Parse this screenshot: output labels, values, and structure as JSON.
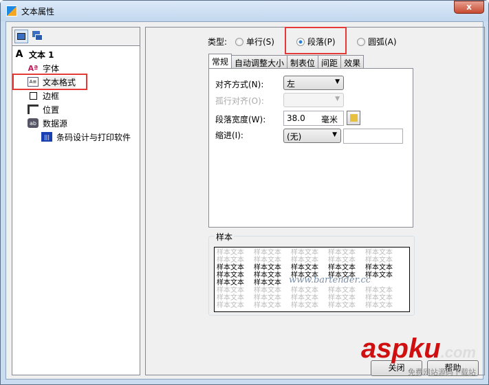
{
  "window": {
    "title": "文本属性",
    "close": "x"
  },
  "tree": {
    "root": "文本 1",
    "items": [
      "字体",
      "文本格式",
      "边框",
      "位置",
      "数据源"
    ],
    "sub": "条码设计与打印软件"
  },
  "type": {
    "label": "类型:",
    "options": [
      "单行(S)",
      "段落(P)",
      "圆弧(A)"
    ],
    "selected": 1
  },
  "tabs": [
    "常规",
    "自动调整大小",
    "制表位",
    "间距",
    "效果"
  ],
  "form": {
    "align_label": "对齐方式(N):",
    "align_value": "左",
    "orphan_label": "孤行对齐(O):",
    "width_label": "段落宽度(W):",
    "width_value": "38.0",
    "width_unit": "毫米",
    "indent_label": "缩进(I):",
    "indent_value": "(无)",
    "indent_input": ""
  },
  "sample": {
    "title": "样本",
    "text": "样本文本",
    "url": "www.bartender.cc"
  },
  "buttons": {
    "close": "关闭",
    "help": "帮助"
  },
  "watermark": {
    "brand": "aspku",
    ".com": ".com",
    "sub": "免费网站源码下载站"
  }
}
